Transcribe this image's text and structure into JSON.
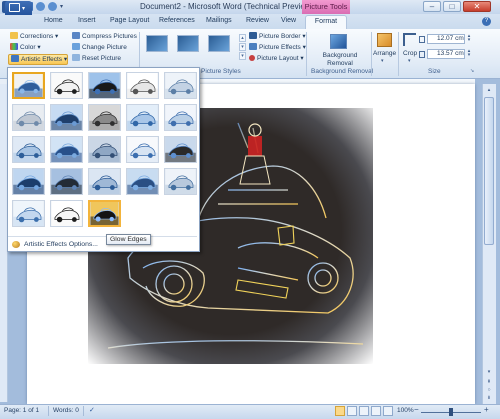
{
  "window": {
    "title": "Document2 - Microsoft Word (Technical Preview)",
    "context_tab_group": "Picture Tools"
  },
  "tabs": [
    {
      "label": "Home"
    },
    {
      "label": "Insert"
    },
    {
      "label": "Page Layout"
    },
    {
      "label": "References"
    },
    {
      "label": "Mailings"
    },
    {
      "label": "Review"
    },
    {
      "label": "View"
    },
    {
      "label": "Format"
    }
  ],
  "ribbon": {
    "adjust": {
      "corrections": "Corrections",
      "color": "Color",
      "artistic_effects": "Artistic Effects",
      "compress": "Compress Pictures",
      "change": "Change Picture",
      "reset": "Reset Picture"
    },
    "picture_styles": {
      "label": "Picture Styles",
      "border": "Picture Border",
      "effects": "Picture Effects",
      "layout": "Picture Layout"
    },
    "background_removal": {
      "button": "Background Removal",
      "group_label": "Background Removal"
    },
    "arrange": {
      "label": "Arrange"
    },
    "size": {
      "crop": "Crop",
      "height": "12.07 cm",
      "width": "13.57 cm",
      "group_label": "Size"
    }
  },
  "gallery": {
    "hover_tooltip": "Glow Edges",
    "options_label": "Artistic Effects Options...",
    "thumb_styles": [
      "normal",
      "outline",
      "dark",
      "sketch",
      "pencil-light",
      "mosaic",
      "blur",
      "gray",
      "blue-wash",
      "light-wash",
      "crosshatch",
      "soft",
      "cement",
      "glass",
      "film-grain",
      "cutout",
      "mono-dark",
      "texture",
      "photocopy",
      "paint",
      "light-blue",
      "bw-sketch",
      "glow-edges"
    ],
    "selected_index": 0,
    "hovered_index": 22
  },
  "status": {
    "page": "Page: 1 of 1",
    "words": "Words: 0",
    "zoom": "100%"
  },
  "colors": {
    "accent": "#2b579a",
    "context_tab": "#e17bc2",
    "selection": "#f8c653"
  }
}
